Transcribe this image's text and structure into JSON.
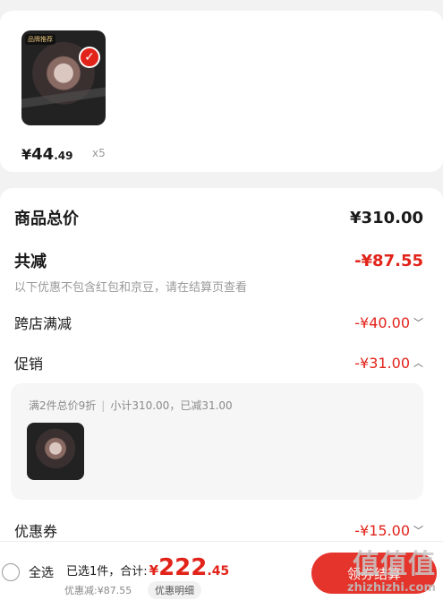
{
  "item": {
    "image_tag": "品牌推荐",
    "price_symbol": "¥",
    "price_int": "44",
    "price_dec": ".49",
    "quantity": "x5"
  },
  "summary": {
    "total_label": "商品总价",
    "total_value": "¥310.00",
    "reduce_label": "共减",
    "reduce_value": "-¥87.55",
    "note": "以下优惠不包含红包和京豆，请在结算页查看",
    "cross_label": "跨店满减",
    "cross_value": "-¥40.00",
    "promo_label": "促销",
    "promo_value": "-¥31.00",
    "promo_detail_a": "满2件总价9折",
    "promo_detail_b": "小计310.00，已减31.00",
    "coupon_label": "优惠券",
    "coupon_value": "-¥15.00"
  },
  "footer": {
    "select_all": "全选",
    "selected_text": "已选1件，合计:",
    "amount_symbol": "¥",
    "amount_int": "222",
    "amount_dec": ".45",
    "discount_text": "优惠减:¥87.55",
    "detail_btn": "优惠明细",
    "checkout_label": "领券结算"
  },
  "watermark": {
    "big": "值值值",
    "small": "zhizhizhi.com"
  },
  "colors": {
    "accent": "#e2231a",
    "background": "#f2f2f2"
  }
}
